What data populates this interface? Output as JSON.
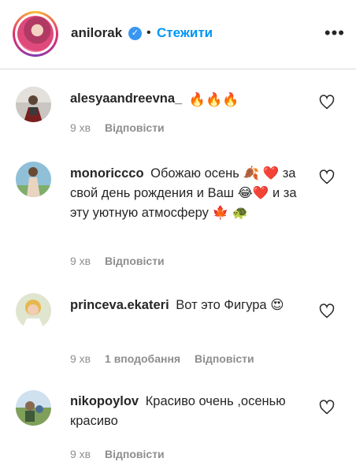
{
  "post_header": {
    "username": "anilorak",
    "separator": "•",
    "follow_label": "Стежити",
    "more_label": "•••"
  },
  "comments": [
    {
      "username": "alesyaandreevna_",
      "text": "🔥🔥🔥",
      "time": "9 хв",
      "likes": "",
      "reply_label": "Відповісти"
    },
    {
      "username": "monoriccco",
      "text": "Обожаю осень 🍂 ❤️ за свой день рождения и Ваш 😂❤️ и за эту уютную атмосферу 🍁 🐢",
      "time": "9 хв",
      "likes": "",
      "reply_label": "Відповісти"
    },
    {
      "username": "princeva.ekateri",
      "text": "Вот это Фигура 😍",
      "time": "9 хв",
      "likes": "1 вподобання",
      "reply_label": "Відповісти"
    },
    {
      "username": "nikopoylov",
      "text": "Красиво очень ,осенью красиво",
      "time": "9 хв",
      "likes": "",
      "reply_label": "Відповісти"
    }
  ],
  "colors": {
    "link_blue": "#0095f6",
    "verified_blue": "#3897f0",
    "meta_gray": "#8e8e8e",
    "text": "#262626"
  }
}
